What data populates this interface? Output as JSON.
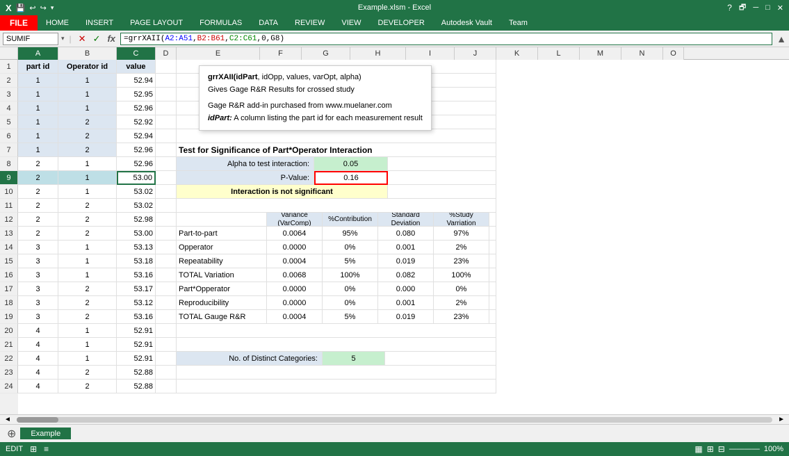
{
  "titlebar": {
    "title": "Example.xlsm - Excel",
    "help_icon": "?",
    "restore_icon": "🗗",
    "minimize_icon": "─",
    "maximize_icon": "□",
    "close_icon": "✕"
  },
  "quickaccess": {
    "icons": [
      "✦",
      "↩",
      "↪",
      "💾",
      "12",
      "fx",
      "|||"
    ]
  },
  "ribbon": {
    "file_label": "FILE",
    "tabs": [
      "HOME",
      "INSERT",
      "PAGE LAYOUT",
      "FORMULAS",
      "DATA",
      "REVIEW",
      "VIEW",
      "DEVELOPER",
      "Autodesk Vault",
      "Team"
    ]
  },
  "formulabar": {
    "name_box": "SUMIF",
    "cancel_icon": "✕",
    "confirm_icon": "✓",
    "fx_icon": "fx",
    "formula": "=grrXAll(A2:A​51,B2:B61,C2:C61,0,G8)",
    "formula_display": "=grrXAII(A2:A51,B2:B61,C2:C61,0,G8)"
  },
  "tooltip": {
    "function_sig": "grrXAII(idPart, idOpp, values, varOpt, alpha)",
    "description": "Gives Gage R&R Results for crossed study",
    "brand": "Gage R&R add-in purchased from www.muelaner.com",
    "param_name": "idPart:",
    "param_desc": "A column listing the part id for each measurement result"
  },
  "columns": [
    "A",
    "B",
    "C",
    "D",
    "E",
    "F",
    "G",
    "H",
    "I",
    "J",
    "K",
    "L",
    "M",
    "N",
    "O"
  ],
  "rows": [
    {
      "num": 1,
      "a": "part id",
      "b": "Operator id",
      "c": "value",
      "d": "",
      "e": "",
      "f": "",
      "g": "",
      "h": "",
      "i": ""
    },
    {
      "num": 2,
      "a": "1",
      "b": "1",
      "c": "52.94",
      "d": "",
      "e": "",
      "f": "",
      "g": "",
      "h": "",
      "i": ""
    },
    {
      "num": 3,
      "a": "1",
      "b": "1",
      "c": "52.95",
      "d": "",
      "e": "",
      "f": "",
      "g": "",
      "h": "",
      "i": ""
    },
    {
      "num": 4,
      "a": "1",
      "b": "1",
      "c": "52.96",
      "d": "",
      "e": "",
      "f": "",
      "g": "",
      "h": "",
      "i": ""
    },
    {
      "num": 5,
      "a": "1",
      "b": "2",
      "c": "52.92",
      "d": "",
      "e": "",
      "f": "",
      "g": "",
      "h": "",
      "i": ""
    },
    {
      "num": 6,
      "a": "1",
      "b": "2",
      "c": "52.94",
      "d": "",
      "e": "",
      "f": "",
      "g": "",
      "h": "",
      "i": ""
    },
    {
      "num": 7,
      "a": "1",
      "b": "2",
      "c": "52.96",
      "d": "",
      "e": "",
      "f": "",
      "g": "",
      "h": "",
      "i": ""
    },
    {
      "num": 8,
      "a": "2",
      "b": "1",
      "c": "52.96",
      "d": "",
      "e": "",
      "f": "",
      "g": "",
      "h": "",
      "i": ""
    },
    {
      "num": 9,
      "a": "2",
      "b": "1",
      "c": "53.00",
      "d": "",
      "e": "",
      "f": "",
      "g": "",
      "h": "",
      "i": ""
    },
    {
      "num": 10,
      "a": "2",
      "b": "1",
      "c": "53.02",
      "d": "",
      "e": "",
      "f": "",
      "g": "",
      "h": "",
      "i": ""
    },
    {
      "num": 11,
      "a": "2",
      "b": "2",
      "c": "53.02",
      "d": "",
      "e": "",
      "f": "",
      "g": "",
      "h": "",
      "i": ""
    },
    {
      "num": 12,
      "a": "2",
      "b": "2",
      "c": "52.98",
      "d": "",
      "e": "",
      "f": "",
      "g": "",
      "h": "",
      "i": ""
    },
    {
      "num": 13,
      "a": "2",
      "b": "2",
      "c": "53.00",
      "d": "",
      "e": "",
      "f": "",
      "g": "",
      "h": "",
      "i": ""
    },
    {
      "num": 14,
      "a": "3",
      "b": "1",
      "c": "53.13",
      "d": "",
      "e": "",
      "f": "",
      "g": "",
      "h": "",
      "i": ""
    },
    {
      "num": 15,
      "a": "3",
      "b": "1",
      "c": "53.18",
      "d": "",
      "e": "",
      "f": "",
      "g": "",
      "h": "",
      "i": ""
    },
    {
      "num": 16,
      "a": "3",
      "b": "1",
      "c": "53.16",
      "d": "",
      "e": "",
      "f": "",
      "g": "",
      "h": "",
      "i": ""
    },
    {
      "num": 17,
      "a": "3",
      "b": "2",
      "c": "53.17",
      "d": "",
      "e": "",
      "f": "",
      "g": "",
      "h": "",
      "i": ""
    },
    {
      "num": 18,
      "a": "3",
      "b": "2",
      "c": "53.12",
      "d": "",
      "e": "",
      "f": "",
      "g": "",
      "h": "",
      "i": ""
    },
    {
      "num": 19,
      "a": "3",
      "b": "2",
      "c": "53.16",
      "d": "",
      "e": "",
      "f": "",
      "g": "",
      "h": "",
      "i": ""
    },
    {
      "num": 20,
      "a": "4",
      "b": "1",
      "c": "52.91",
      "d": "",
      "e": "",
      "f": "",
      "g": "",
      "h": "",
      "i": ""
    },
    {
      "num": 21,
      "a": "4",
      "b": "1",
      "c": "52.91",
      "d": "",
      "e": "",
      "f": "",
      "g": "",
      "h": "",
      "i": ""
    },
    {
      "num": 22,
      "a": "4",
      "b": "1",
      "c": "52.91",
      "d": "",
      "e": "",
      "f": "",
      "g": "",
      "h": "",
      "i": ""
    },
    {
      "num": 23,
      "a": "4",
      "b": "2",
      "c": "52.88",
      "d": "",
      "e": "",
      "f": "",
      "g": "",
      "h": "",
      "i": ""
    },
    {
      "num": 24,
      "a": "4",
      "b": "2",
      "c": "52.88",
      "d": "",
      "e": "",
      "f": "",
      "g": "",
      "h": "",
      "i": ""
    }
  ],
  "table": {
    "title": "Test for Significance of Part*Operator Interaction",
    "alpha_label": "Alpha to test interaction:",
    "alpha_value": "0.05",
    "pvalue_label": "P-Value:",
    "pvalue_value": "0.16",
    "interaction_msg": "Interaction is not significant",
    "headers": [
      "Variance\n(VarComp)",
      "%Contribution",
      "Standard\nDeviation",
      "%Study\nVarriation"
    ],
    "rows": [
      {
        "label": "Part-to-part",
        "variance": "0.0064",
        "contribution": "95%",
        "stddev": "0.080",
        "study": "97%"
      },
      {
        "label": "Opperator",
        "variance": "0.0000",
        "contribution": "0%",
        "stddev": "0.001",
        "study": "2%"
      },
      {
        "label": "Repeatability",
        "variance": "0.0004",
        "contribution": "5%",
        "stddev": "0.019",
        "study": "23%"
      },
      {
        "label": "TOTAL Variation",
        "variance": "0.0068",
        "contribution": "100%",
        "stddev": "0.082",
        "study": "100%"
      },
      {
        "label": "Part*Opperator",
        "variance": "0.0000",
        "contribution": "0%",
        "stddev": "0.000",
        "study": "0%"
      },
      {
        "label": "Reproducibility",
        "variance": "0.0000",
        "contribution": "0%",
        "stddev": "0.001",
        "study": "2%"
      },
      {
        "label": "TOTAL Gauge R&R",
        "variance": "0.0004",
        "contribution": "5%",
        "stddev": "0.019",
        "study": "23%"
      }
    ],
    "distinct_label": "No. of Distinct Categories:",
    "distinct_value": "5"
  },
  "sheets": [
    "Example"
  ],
  "statusbar": {
    "mode": "EDIT",
    "icons": [
      "⊞",
      "≡"
    ],
    "zoom": "100%",
    "view_icons": [
      "▦",
      "⊞",
      "⊟"
    ]
  }
}
